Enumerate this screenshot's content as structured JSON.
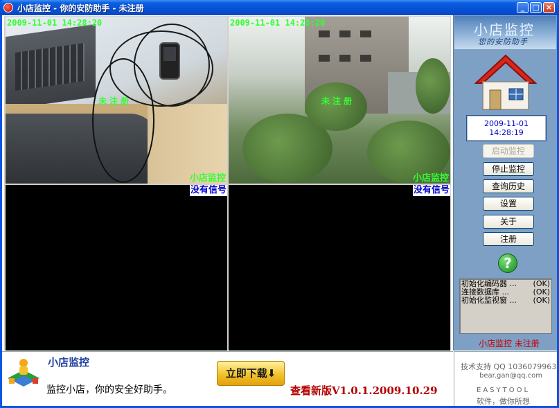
{
  "window": {
    "title": "小店监控 - 你的安防助手 - 未注册",
    "minimize": "_",
    "maximize": "□",
    "close": "×"
  },
  "cameras": [
    {
      "timestamp": "2009-11-01 14:28:20",
      "watermark": "未注册",
      "name": "小店监控",
      "status": ""
    },
    {
      "timestamp": "2009-11-01 14:28:20",
      "watermark": "未注册",
      "name": "小店监控",
      "status": ""
    },
    {
      "timestamp": "",
      "watermark": "",
      "name": "",
      "status": "没有信号"
    },
    {
      "timestamp": "",
      "watermark": "",
      "name": "",
      "status": "没有信号"
    }
  ],
  "side": {
    "brand_title": "小店监控",
    "brand_subtitle": "您的安防助手",
    "date": "2009-11-01",
    "time": "14:28:19",
    "buttons": {
      "start": "启动监控",
      "stop": "停止监控",
      "history": "查询历史",
      "settings": "设置",
      "about": "关于",
      "register": "注册"
    },
    "help_symbol": "?",
    "log": [
      {
        "label": "初始化编码器 ...",
        "status": "(OK)"
      },
      {
        "label": "连接数据库 ...",
        "status": "(OK)"
      },
      {
        "label": "初始化监视窗 ...",
        "status": "(OK)"
      }
    ],
    "registration": "小店监控 未注册"
  },
  "ad": {
    "title": "小店监控",
    "description": "监控小店，你的安全好助手。",
    "download": "立即下载⬇",
    "new_version": "查看新版V1.0.1.2009.10.29"
  },
  "info": {
    "support": "技术支持 QQ 1036079963",
    "email": "bear.gan@qq.com",
    "company": "EASYTOOL",
    "slogan": "软件，做你所想"
  },
  "colors": {
    "title_bar": "#0651d6",
    "overlay_text": "#33ff33",
    "no_signal": "#0000cc",
    "panel": "#7da0c4",
    "registration": "#cc0000"
  }
}
